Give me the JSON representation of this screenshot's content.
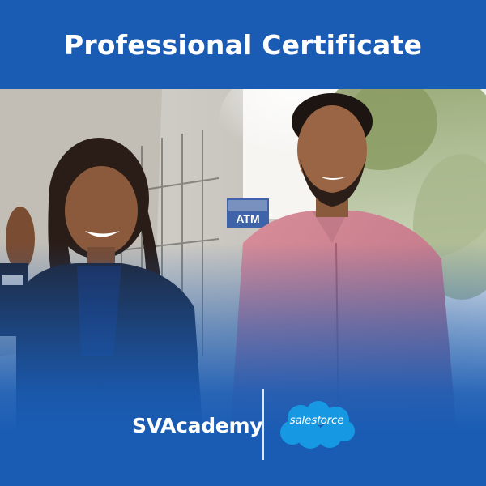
{
  "header": {
    "title": "Professional Certificate"
  },
  "photo": {
    "sign_text": "ATM"
  },
  "logos": {
    "sva_label": "SVAcademy",
    "salesforce_label": "salesforce"
  },
  "colors": {
    "brand_blue": "#1a5cb4",
    "salesforce_blue": "#1798e3"
  }
}
